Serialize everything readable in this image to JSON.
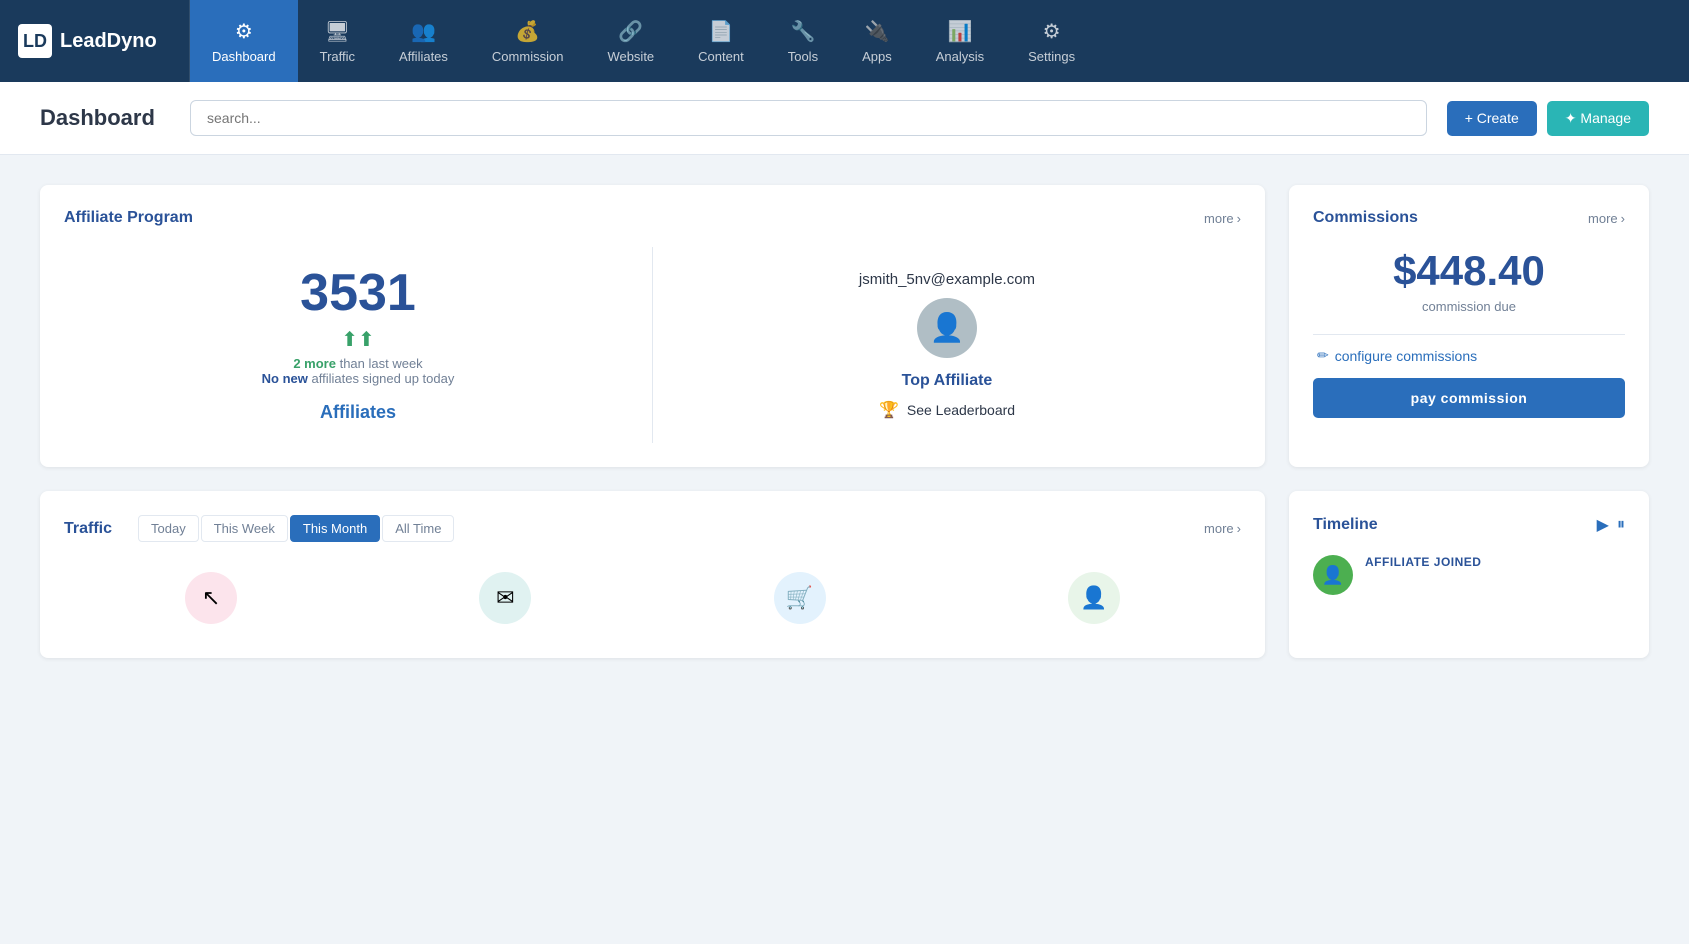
{
  "brand": {
    "logo_letter": "LD",
    "name": "LeadDyno"
  },
  "nav": {
    "items": [
      {
        "id": "dashboard",
        "label": "Dashboard",
        "icon": "⚙",
        "active": true
      },
      {
        "id": "traffic",
        "label": "Traffic",
        "icon": "🖥"
      },
      {
        "id": "affiliates",
        "label": "Affiliates",
        "icon": "👥"
      },
      {
        "id": "commission",
        "label": "Commission",
        "icon": "💰"
      },
      {
        "id": "website",
        "label": "Website",
        "icon": "🔗"
      },
      {
        "id": "content",
        "label": "Content",
        "icon": "📄"
      },
      {
        "id": "tools",
        "label": "Tools",
        "icon": "🔧"
      },
      {
        "id": "apps",
        "label": "Apps",
        "icon": "🔌"
      },
      {
        "id": "analysis",
        "label": "Analysis",
        "icon": "📊"
      },
      {
        "id": "settings",
        "label": "Settings",
        "icon": "⚙"
      }
    ]
  },
  "header": {
    "title": "Dashboard",
    "search_placeholder": "search...",
    "create_label": "+ Create",
    "manage_label": "✦ Manage"
  },
  "affiliate_program": {
    "title": "Affiliate Program",
    "more_label": "more",
    "count": "3531",
    "up_arrow": "⬆",
    "stat_more": "2 more",
    "stat_more_suffix": " than last week",
    "stat_no_new": "No new",
    "stat_no_new_suffix": " affiliates signed up today",
    "affiliates_link": "Affiliates",
    "top_affiliate_email": "jsmith_5nv@example.com",
    "top_affiliate_label": "Top Affiliate",
    "leaderboard_label": "See Leaderboard"
  },
  "commissions": {
    "title": "Commissions",
    "more_label": "more",
    "amount": "$448.40",
    "due_label": "commission due",
    "configure_label": "configure commissions",
    "pay_label": "pay commission"
  },
  "traffic": {
    "title": "Traffic",
    "more_label": "more",
    "periods": [
      "Today",
      "This Week",
      "This Month",
      "All Time"
    ],
    "active_period": "This Month",
    "icons": [
      {
        "id": "cursor",
        "symbol": "↖",
        "color": "pink"
      },
      {
        "id": "email",
        "symbol": "✉",
        "color": "teal"
      },
      {
        "id": "cart",
        "symbol": "🛒",
        "color": "blue"
      },
      {
        "id": "person",
        "symbol": "👤",
        "color": "green"
      }
    ]
  },
  "timeline": {
    "title": "Timeline",
    "play_icon": "▶",
    "pause_icon": "⏸",
    "item": {
      "label": "AFFILIATE JOINED",
      "text": ""
    }
  }
}
